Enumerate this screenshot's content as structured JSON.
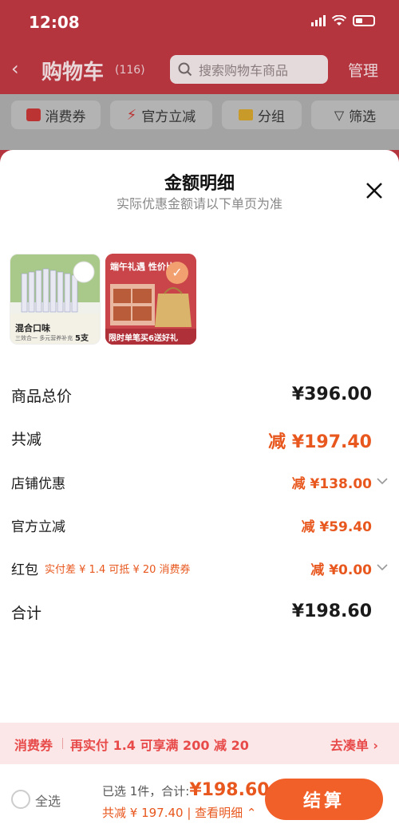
{
  "status": {
    "time": "12:08"
  },
  "nav": {
    "title": "购物车",
    "count": "(116)",
    "search_placeholder": "搜索购物车商品",
    "manage": "管理"
  },
  "filters": [
    {
      "label": "消费券",
      "icon": "coupon-icon"
    },
    {
      "label": "官方立减",
      "icon": "lightning-icon"
    },
    {
      "label": "分组",
      "icon": "folder-icon"
    },
    {
      "label": "筛选",
      "icon": "filter-icon"
    }
  ],
  "sheet": {
    "title": "金额明细",
    "subtitle": "实际优惠金额请以下单页为准",
    "products": [
      {
        "name": "混合口味",
        "sub": "三效合一 多元营养补充",
        "qty": "5支"
      },
      {
        "banner": "端午礼遇 性价比",
        "promo": "限时单笔买6送好礼"
      }
    ],
    "rows": {
      "total": {
        "label": "商品总价",
        "value": "¥396.00"
      },
      "discount": {
        "label": "共减",
        "value": "减 ¥197.40"
      },
      "store": {
        "label": "店铺优惠",
        "value": "减 ¥138.00"
      },
      "official": {
        "label": "官方立减",
        "value": "减 ¥59.40"
      },
      "redpacket": {
        "label": "红包",
        "note": "实付差 ¥ 1.4 可抵 ¥ 20 消费券",
        "value": "减 ¥0.00"
      },
      "sum": {
        "label": "合计",
        "value": "¥198.60"
      }
    }
  },
  "coupon_bar": {
    "tag": "消费券",
    "text": "再实付 1.4 可享满 200 减 20",
    "action": "去凑单 ›"
  },
  "bottom": {
    "select_all": "全选",
    "selected": "已选 1件，合计:",
    "total": "¥198.60",
    "saved": "共减 ¥ 197.40 | 查看明细 ⌃",
    "checkout": "结算"
  },
  "colors": {
    "accent": "#f2602a",
    "discount": "#e8571d",
    "header": "#b5353f"
  }
}
